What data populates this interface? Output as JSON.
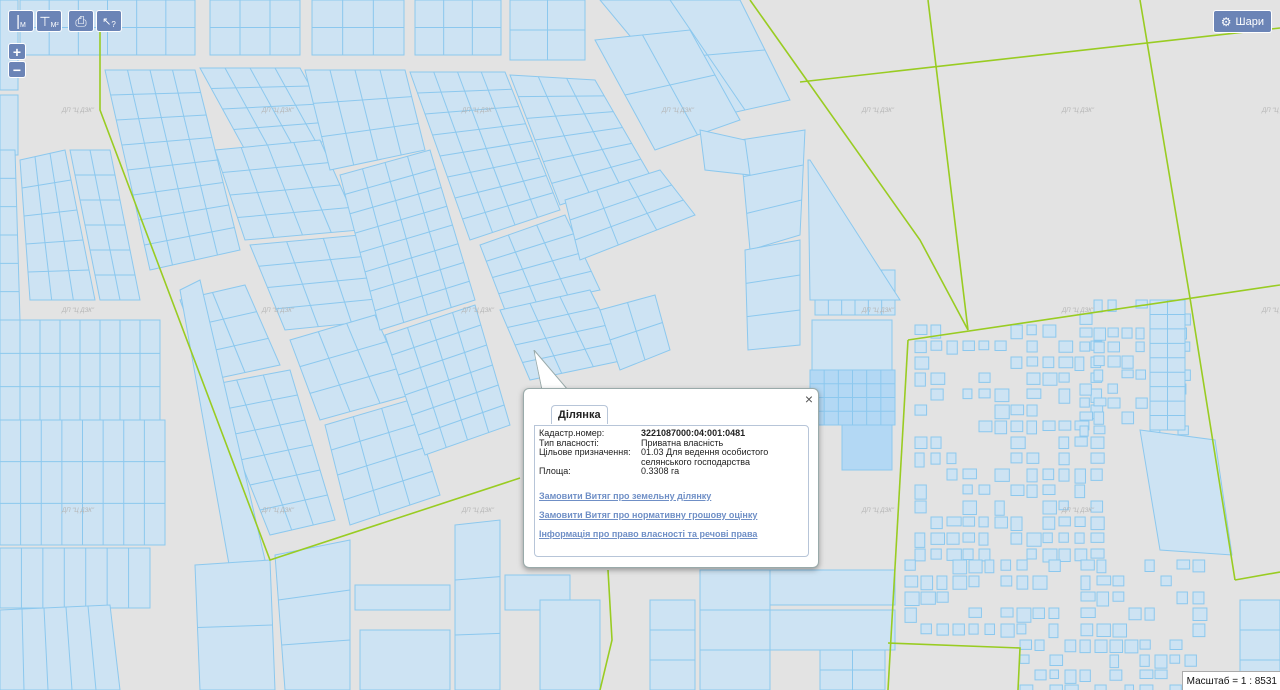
{
  "toolbar": {
    "measure_label": "М",
    "area_label": "М²",
    "print_label": "⎙",
    "info_label": "?"
  },
  "zoom": {
    "in_label": "+",
    "out_label": "−"
  },
  "layers": {
    "label": "Шари"
  },
  "popup": {
    "close_label": "×",
    "tab_label": "Ділянка",
    "rows": [
      {
        "label": "Кадастр.номер:",
        "value": "3221087000:04:001:0481"
      },
      {
        "label": "Тип власності:",
        "value": "Приватна власність"
      },
      {
        "label": "Цільове призначення:",
        "value": "01.03 Для ведення особистого селянського господарства"
      },
      {
        "label": "Площа:",
        "value": "0.3308 га"
      }
    ],
    "links": [
      "Замовити Витяг про земельну ділянку",
      "Замовити Витяг про нормативну грошову оцінку",
      "Інформація про право власності та речові права"
    ]
  },
  "scale": {
    "label": "Масштаб = 1 : 8531"
  },
  "map": {
    "watermark": "ДП \"Ц ДЗК\"",
    "colors": {
      "background": "#e3e3e3",
      "parcel_fill": "#cde3f3",
      "parcel_stroke": "#8cc8ee",
      "highlight_fill": "#b3d8f4",
      "boundary": "#99cc22",
      "toolbar": "#6b84b6",
      "link": "#6f8fc6"
    }
  }
}
